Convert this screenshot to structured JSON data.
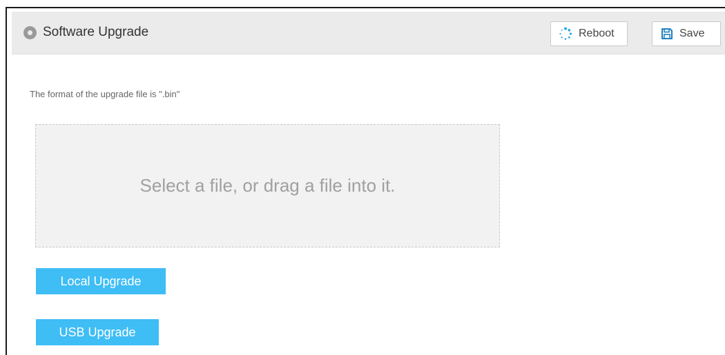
{
  "header": {
    "title": "Software Upgrade",
    "title_icon": "circle-dot-icon",
    "reboot_label": "Reboot",
    "reboot_icon": "spinner-icon",
    "save_label": "Save",
    "save_icon": "floppy-disk-icon"
  },
  "content": {
    "format_note": "The format of the upgrade file is \".bin\"",
    "dropzone_text": "Select a file, or drag a file into it.",
    "local_upgrade_label": "Local Upgrade",
    "usb_upgrade_label": "USB Upgrade"
  },
  "colors": {
    "accent": "#3fbdf5",
    "reboot_icon_color": "#29a8e0",
    "save_icon_color": "#1f7fc0",
    "header_bg": "#ebebeb",
    "dropzone_bg": "#f2f2f2"
  }
}
